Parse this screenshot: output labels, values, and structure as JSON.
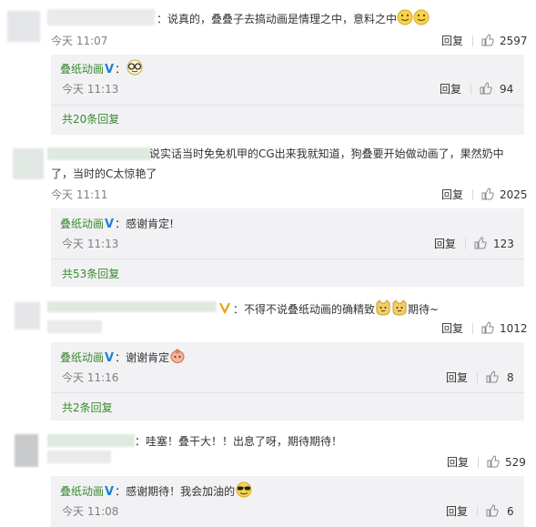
{
  "thread": [
    {
      "text": "：说真的，叠叠子去搞动画是情理之中，意料之中",
      "time": "今天 11:07",
      "reply_label": "回复",
      "likes": "2597",
      "emoji": [
        "smile",
        "smile"
      ],
      "sub_reply": {
        "author": "叠纸动画",
        "colon": "：",
        "text": "",
        "emoji": [
          "glasses"
        ],
        "time": "今天 11:13",
        "reply_label": "回复",
        "likes": "94"
      },
      "more": "共20条回复"
    },
    {
      "text_line1": "说实话当时免免机甲的CG出来我就知道，狗叠要开始做动画了，果然奶中",
      "text_line2": "了，当时的C太惊艳了",
      "time": "今天 11:11",
      "reply_label": "回复",
      "likes": "2025",
      "sub_reply": {
        "author": "叠纸动画",
        "colon": "：",
        "text": "感谢肯定!",
        "time": "今天 11:13",
        "reply_label": "回复",
        "likes": "123"
      },
      "more": "共53条回复"
    },
    {
      "text": "：不得不说叠纸动画的确精致",
      "text_after": "期待~",
      "emoji": [
        "cat",
        "cat"
      ],
      "reply_label": "回复",
      "likes": "1012",
      "sub_reply": {
        "author": "叠纸动画",
        "colon": "：",
        "text": "谢谢肯定",
        "emoji": [
          "bun"
        ],
        "time": "今天 11:16",
        "reply_label": "回复",
        "likes": "8"
      },
      "more": "共2条回复"
    },
    {
      "text": "：哇塞！叠干大！！出息了呀，期待期待！",
      "reply_label": "回复",
      "likes": "529",
      "sub_reply": {
        "author": "叠纸动画",
        "colon": "：",
        "text": "感谢期待！我会加油的",
        "emoji": [
          "cool"
        ],
        "time": "今天 11:08",
        "reply_label": "回复",
        "likes": "6"
      }
    }
  ],
  "colors": {
    "author_green": "#3b8a2e",
    "verified_blue": "#1e7fd6",
    "time_gray": "#808080",
    "subreply_bg": "#f2f2f5"
  }
}
